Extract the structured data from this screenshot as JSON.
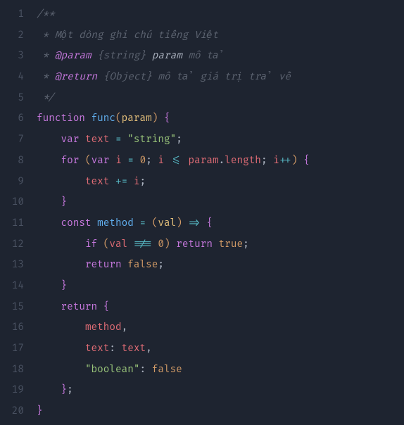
{
  "lines": [
    {
      "n": 1,
      "tokens": [
        {
          "c": "cmt",
          "t": "/**"
        }
      ]
    },
    {
      "n": 2,
      "tokens": [
        {
          "c": "cmt",
          "t": " * Một dòng ghi chú tiếng Việt"
        }
      ]
    },
    {
      "n": 3,
      "tokens": [
        {
          "c": "cmt",
          "t": " * "
        },
        {
          "c": "cmt-tag",
          "t": "@param"
        },
        {
          "c": "cmt",
          "t": " "
        },
        {
          "c": "cmt-type",
          "t": "{string}"
        },
        {
          "c": "cmt",
          "t": " "
        },
        {
          "c": "cmt-param",
          "t": "param"
        },
        {
          "c": "cmt",
          "t": " mô tả"
        }
      ]
    },
    {
      "n": 4,
      "tokens": [
        {
          "c": "cmt",
          "t": " * "
        },
        {
          "c": "cmt-tag",
          "t": "@return"
        },
        {
          "c": "cmt",
          "t": " "
        },
        {
          "c": "cmt-type",
          "t": "{Object}"
        },
        {
          "c": "cmt",
          "t": " mô tả giá trị trả về"
        }
      ]
    },
    {
      "n": 5,
      "tokens": [
        {
          "c": "cmt",
          "t": " */"
        }
      ]
    },
    {
      "n": 6,
      "tokens": [
        {
          "c": "kw",
          "t": "function"
        },
        {
          "c": "punc",
          "t": " "
        },
        {
          "c": "fn",
          "t": "func"
        },
        {
          "c": "paren1",
          "t": "("
        },
        {
          "c": "param",
          "t": "param"
        },
        {
          "c": "paren1",
          "t": ")"
        },
        {
          "c": "punc",
          "t": " "
        },
        {
          "c": "brace",
          "t": "{"
        }
      ]
    },
    {
      "n": 7,
      "indent": 1,
      "tokens": [
        {
          "c": "kw",
          "t": "var"
        },
        {
          "c": "punc",
          "t": " "
        },
        {
          "c": "var",
          "t": "text"
        },
        {
          "c": "punc",
          "t": " "
        },
        {
          "c": "op",
          "t": "="
        },
        {
          "c": "punc",
          "t": " "
        },
        {
          "c": "str",
          "t": "\"string\""
        },
        {
          "c": "punc",
          "t": ";"
        }
      ]
    },
    {
      "n": 8,
      "indent": 1,
      "tokens": [
        {
          "c": "kw",
          "t": "for"
        },
        {
          "c": "punc",
          "t": " "
        },
        {
          "c": "paren1",
          "t": "("
        },
        {
          "c": "kw",
          "t": "var"
        },
        {
          "c": "punc",
          "t": " "
        },
        {
          "c": "var",
          "t": "i"
        },
        {
          "c": "punc",
          "t": " "
        },
        {
          "c": "op",
          "t": "="
        },
        {
          "c": "punc",
          "t": " "
        },
        {
          "c": "num",
          "t": "0"
        },
        {
          "c": "punc",
          "t": "; "
        },
        {
          "c": "var",
          "t": "i"
        },
        {
          "c": "punc",
          "t": " "
        },
        {
          "c": "op",
          "t": "<="
        },
        {
          "c": "punc",
          "t": " "
        },
        {
          "c": "var",
          "t": "param"
        },
        {
          "c": "punc",
          "t": "."
        },
        {
          "c": "prop",
          "t": "length"
        },
        {
          "c": "punc",
          "t": "; "
        },
        {
          "c": "var",
          "t": "i"
        },
        {
          "c": "op",
          "t": "++"
        },
        {
          "c": "paren1",
          "t": ")"
        },
        {
          "c": "punc",
          "t": " "
        },
        {
          "c": "brace",
          "t": "{"
        }
      ]
    },
    {
      "n": 9,
      "indent": 2,
      "tokens": [
        {
          "c": "var",
          "t": "text"
        },
        {
          "c": "punc",
          "t": " "
        },
        {
          "c": "op",
          "t": "+="
        },
        {
          "c": "punc",
          "t": " "
        },
        {
          "c": "var",
          "t": "i"
        },
        {
          "c": "punc",
          "t": ";"
        }
      ]
    },
    {
      "n": 10,
      "indent": 1,
      "tokens": [
        {
          "c": "brace",
          "t": "}"
        }
      ]
    },
    {
      "n": 11,
      "indent": 1,
      "tokens": [
        {
          "c": "kw",
          "t": "const"
        },
        {
          "c": "punc",
          "t": " "
        },
        {
          "c": "fn",
          "t": "method"
        },
        {
          "c": "punc",
          "t": " "
        },
        {
          "c": "op",
          "t": "="
        },
        {
          "c": "punc",
          "t": " "
        },
        {
          "c": "paren1",
          "t": "("
        },
        {
          "c": "param",
          "t": "val"
        },
        {
          "c": "paren1",
          "t": ")"
        },
        {
          "c": "punc",
          "t": " "
        },
        {
          "c": "op",
          "t": "=>"
        },
        {
          "c": "punc",
          "t": " "
        },
        {
          "c": "brace",
          "t": "{"
        }
      ]
    },
    {
      "n": 12,
      "indent": 2,
      "tokens": [
        {
          "c": "kw",
          "t": "if"
        },
        {
          "c": "punc",
          "t": " "
        },
        {
          "c": "paren1",
          "t": "("
        },
        {
          "c": "var",
          "t": "val"
        },
        {
          "c": "punc",
          "t": " "
        },
        {
          "c": "op",
          "t": "!=="
        },
        {
          "c": "punc",
          "t": " "
        },
        {
          "c": "num",
          "t": "0"
        },
        {
          "c": "paren1",
          "t": ")"
        },
        {
          "c": "punc",
          "t": " "
        },
        {
          "c": "kw",
          "t": "return"
        },
        {
          "c": "punc",
          "t": " "
        },
        {
          "c": "bool",
          "t": "true"
        },
        {
          "c": "punc",
          "t": ";"
        }
      ]
    },
    {
      "n": 13,
      "indent": 2,
      "tokens": [
        {
          "c": "kw",
          "t": "return"
        },
        {
          "c": "punc",
          "t": " "
        },
        {
          "c": "bool",
          "t": "false"
        },
        {
          "c": "punc",
          "t": ";"
        }
      ]
    },
    {
      "n": 14,
      "indent": 1,
      "tokens": [
        {
          "c": "brace",
          "t": "}"
        }
      ]
    },
    {
      "n": 15,
      "indent": 1,
      "tokens": [
        {
          "c": "kw",
          "t": "return"
        },
        {
          "c": "punc",
          "t": " "
        },
        {
          "c": "brace",
          "t": "{"
        }
      ]
    },
    {
      "n": 16,
      "indent": 2,
      "tokens": [
        {
          "c": "var",
          "t": "method"
        },
        {
          "c": "punc",
          "t": ","
        }
      ]
    },
    {
      "n": 17,
      "indent": 2,
      "tokens": [
        {
          "c": "var",
          "t": "text"
        },
        {
          "c": "punc",
          "t": ": "
        },
        {
          "c": "var",
          "t": "text"
        },
        {
          "c": "punc",
          "t": ","
        }
      ]
    },
    {
      "n": 18,
      "indent": 2,
      "tokens": [
        {
          "c": "str",
          "t": "\"boolean\""
        },
        {
          "c": "punc",
          "t": ": "
        },
        {
          "c": "bool",
          "t": "false"
        }
      ]
    },
    {
      "n": 19,
      "indent": 1,
      "tokens": [
        {
          "c": "brace",
          "t": "}"
        },
        {
          "c": "punc",
          "t": ";"
        }
      ]
    },
    {
      "n": 20,
      "tokens": [
        {
          "c": "brace",
          "t": "}"
        }
      ]
    }
  ]
}
